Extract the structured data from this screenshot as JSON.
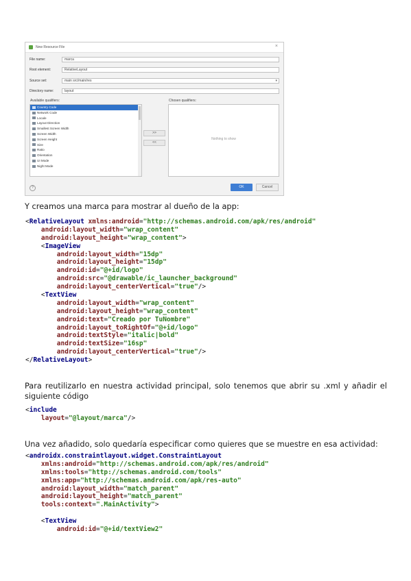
{
  "dialog": {
    "title": "New Resource File",
    "close_glyph": "×",
    "fields": [
      {
        "label": "File name:",
        "value": "marca"
      },
      {
        "label": "Root element:",
        "value": "RelativeLayout"
      },
      {
        "label": "Source set:",
        "value": "main src/main/res"
      },
      {
        "label": "Directory name:",
        "value": "layout"
      }
    ],
    "available_label": "Available qualifiers:",
    "chosen_label": "Chosen qualifiers:",
    "qualifiers": [
      "Country Code",
      "Network Code",
      "Locale",
      "Layout Direction",
      "Smallest Screen Width",
      "Screen Width",
      "Screen Height",
      "Size",
      "Ratio",
      "Orientation",
      "UI Mode",
      "Night Mode"
    ],
    "add_button": ">>",
    "remove_button": "<<",
    "chosen_empty": "Nothing to show",
    "help_glyph": "?",
    "ok_label": "OK",
    "cancel_label": "Cancel"
  },
  "texts": {
    "p1": "Y creamos una marca para mostrar al dueño de la app:",
    "p2": "Para reutilizarlo en nuestra actividad principal, solo tenemos que abrir su .xml y añadir el siguiente código",
    "p3": "Una vez añadido, solo quedaría especificar como quieres que se muestre en esa actividad:"
  },
  "code_blocks": {
    "relative": [
      [
        [
          "<",
          "p"
        ],
        [
          "RelativeLayout ",
          "t"
        ],
        [
          "xmlns:android",
          "a"
        ],
        [
          "=",
          "p"
        ],
        [
          "\"http://schemas.android.com/apk/res/android\"",
          "v"
        ]
      ],
      [
        [
          "    android:layout_width",
          "a"
        ],
        [
          "=",
          "p"
        ],
        [
          "\"wrap_content\"",
          "v"
        ]
      ],
      [
        [
          "    android:layout_height",
          "a"
        ],
        [
          "=",
          "p"
        ],
        [
          "\"wrap_content\"",
          "v"
        ],
        [
          ">",
          "p"
        ]
      ],
      [
        [
          "    <",
          "p"
        ],
        [
          "ImageView",
          "t"
        ]
      ],
      [
        [
          "        android:layout_width",
          "a"
        ],
        [
          "=",
          "p"
        ],
        [
          "\"15dp\"",
          "v"
        ]
      ],
      [
        [
          "        android:layout_height",
          "a"
        ],
        [
          "=",
          "p"
        ],
        [
          "\"15dp\"",
          "v"
        ]
      ],
      [
        [
          "        android:id",
          "a"
        ],
        [
          "=",
          "p"
        ],
        [
          "\"@+id/logo\"",
          "v"
        ]
      ],
      [
        [
          "        android:src",
          "a"
        ],
        [
          "=",
          "p"
        ],
        [
          "\"@drawable/ic_launcher_background\"",
          "v"
        ]
      ],
      [
        [
          "        android:layout_centerVertical",
          "a"
        ],
        [
          "=",
          "p"
        ],
        [
          "\"true\"",
          "v"
        ],
        [
          "/>",
          "p"
        ]
      ],
      [
        [
          "    <",
          "p"
        ],
        [
          "TextView",
          "t"
        ]
      ],
      [
        [
          "        android:layout_width",
          "a"
        ],
        [
          "=",
          "p"
        ],
        [
          "\"wrap_content\"",
          "v"
        ]
      ],
      [
        [
          "        android:layout_height",
          "a"
        ],
        [
          "=",
          "p"
        ],
        [
          "\"wrap_content\"",
          "v"
        ]
      ],
      [
        [
          "        android:text",
          "a"
        ],
        [
          "=",
          "p"
        ],
        [
          "\"Creado por TuNombre\"",
          "v"
        ]
      ],
      [
        [
          "        android:layout_toRightOf",
          "a"
        ],
        [
          "=",
          "p"
        ],
        [
          "\"@+id/logo\"",
          "v"
        ]
      ],
      [
        [
          "        android:textStyle",
          "a"
        ],
        [
          "=",
          "p"
        ],
        [
          "\"italic|bold\"",
          "v"
        ]
      ],
      [
        [
          "        android:textSize",
          "a"
        ],
        [
          "=",
          "p"
        ],
        [
          "\"16sp\"",
          "v"
        ]
      ],
      [
        [
          "        android:layout_centerVertical",
          "a"
        ],
        [
          "=",
          "p"
        ],
        [
          "\"true\"",
          "v"
        ],
        [
          "/>",
          "p"
        ]
      ],
      [
        [
          "</",
          "p"
        ],
        [
          "RelativeLayout",
          "t"
        ],
        [
          ">",
          "p"
        ]
      ]
    ],
    "include": [
      [
        [
          "<",
          "p"
        ],
        [
          "include",
          "t"
        ]
      ],
      [
        [
          "    layout",
          "a"
        ],
        [
          "=",
          "p"
        ],
        [
          "\"@layout/marca\"",
          "v"
        ],
        [
          "/>",
          "p"
        ]
      ]
    ],
    "constraint": [
      [
        [
          "<",
          "p"
        ],
        [
          "androidx.constraintlayout.widget.ConstraintLayout",
          "t"
        ]
      ],
      [
        [
          "    xmlns:android",
          "a"
        ],
        [
          "=",
          "p"
        ],
        [
          "\"http://schemas.android.com/apk/res/android\"",
          "v"
        ]
      ],
      [
        [
          "    xmlns:tools",
          "a"
        ],
        [
          "=",
          "p"
        ],
        [
          "\"http://schemas.android.com/tools\"",
          "v"
        ]
      ],
      [
        [
          "    xmlns:app",
          "a"
        ],
        [
          "=",
          "p"
        ],
        [
          "\"http://schemas.android.com/apk/res-auto\"",
          "v"
        ]
      ],
      [
        [
          "    android:layout_width",
          "a"
        ],
        [
          "=",
          "p"
        ],
        [
          "\"match_parent\"",
          "v"
        ]
      ],
      [
        [
          "    android:layout_height",
          "a"
        ],
        [
          "=",
          "p"
        ],
        [
          "\"match_parent\"",
          "v"
        ]
      ],
      [
        [
          "    tools:context",
          "a"
        ],
        [
          "=",
          "p"
        ],
        [
          "\".MainActivity\"",
          "v"
        ],
        [
          ">",
          "p"
        ]
      ],
      [
        [
          "",
          ""
        ]
      ],
      [
        [
          "    <",
          "p"
        ],
        [
          "TextView",
          "t"
        ]
      ],
      [
        [
          "        android:id",
          "a"
        ],
        [
          "=",
          "p"
        ],
        [
          "\"@+id/textView2\"",
          "v"
        ]
      ]
    ]
  }
}
